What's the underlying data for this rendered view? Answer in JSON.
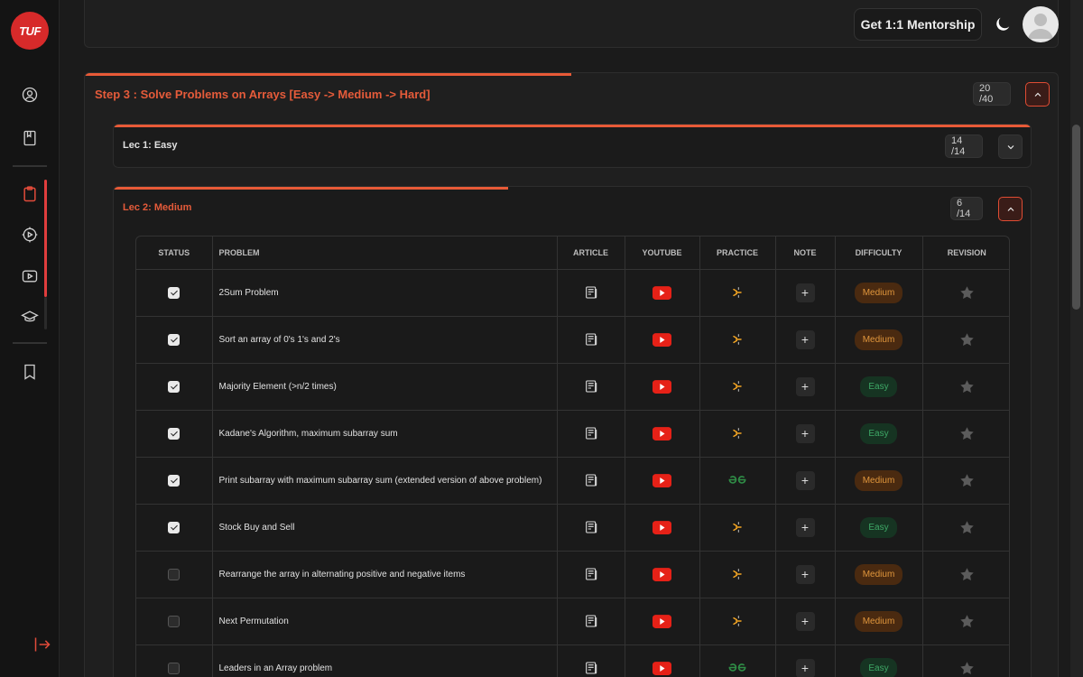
{
  "sidebar": {
    "logo_text": "TUF",
    "icons": [
      "profile-icon",
      "book-icon",
      "clipboard-icon",
      "settings-play-icon",
      "youtube-icon",
      "graduation-cap-icon",
      "bookmark-icon",
      "logout-icon"
    ]
  },
  "header": {
    "mentorship_label": "Get 1:1 Mentorship"
  },
  "step": {
    "title": "Step 3 : Solve Problems on Arrays [Easy -> Medium -> Hard]",
    "count": "20 /40",
    "progress": 0.5
  },
  "lectures": [
    {
      "title": "Lec 1: Easy",
      "count": "14 /14",
      "progress": 1.0,
      "expanded": false
    },
    {
      "title": "Lec 2: Medium",
      "count": "6 /14",
      "progress": 0.43,
      "expanded": true
    }
  ],
  "table": {
    "headers": [
      "Status",
      "Problem",
      "Article",
      "Youtube",
      "Practice",
      "Note",
      "Difficulty",
      "Revision"
    ],
    "rows": [
      {
        "status": true,
        "problem": "2Sum Problem",
        "practice": "codestudio",
        "difficulty": "Medium"
      },
      {
        "status": true,
        "problem": "Sort an array of 0's 1's and 2's",
        "practice": "codestudio",
        "difficulty": "Medium"
      },
      {
        "status": true,
        "problem": "Majority Element (>n/2 times)",
        "practice": "codestudio",
        "difficulty": "Easy"
      },
      {
        "status": true,
        "problem": "Kadane's Algorithm, maximum subarray sum",
        "practice": "codestudio",
        "difficulty": "Easy"
      },
      {
        "status": true,
        "problem": "Print subarray with maximum subarray sum (extended version of above problem)",
        "practice": "gfg",
        "difficulty": "Medium"
      },
      {
        "status": true,
        "problem": "Stock Buy and Sell",
        "practice": "codestudio",
        "difficulty": "Easy"
      },
      {
        "status": false,
        "problem": "Rearrange the array in alternating positive and negative items",
        "practice": "codestudio",
        "difficulty": "Medium"
      },
      {
        "status": false,
        "problem": "Next Permutation",
        "practice": "codestudio",
        "difficulty": "Medium"
      },
      {
        "status": false,
        "problem": "Leaders in an Array problem",
        "practice": "gfg",
        "difficulty": "Easy"
      }
    ]
  },
  "colors": {
    "accent": "#e55b3a",
    "medium": "#e0963c",
    "easy": "#3ea866",
    "youtube": "#e62117"
  }
}
